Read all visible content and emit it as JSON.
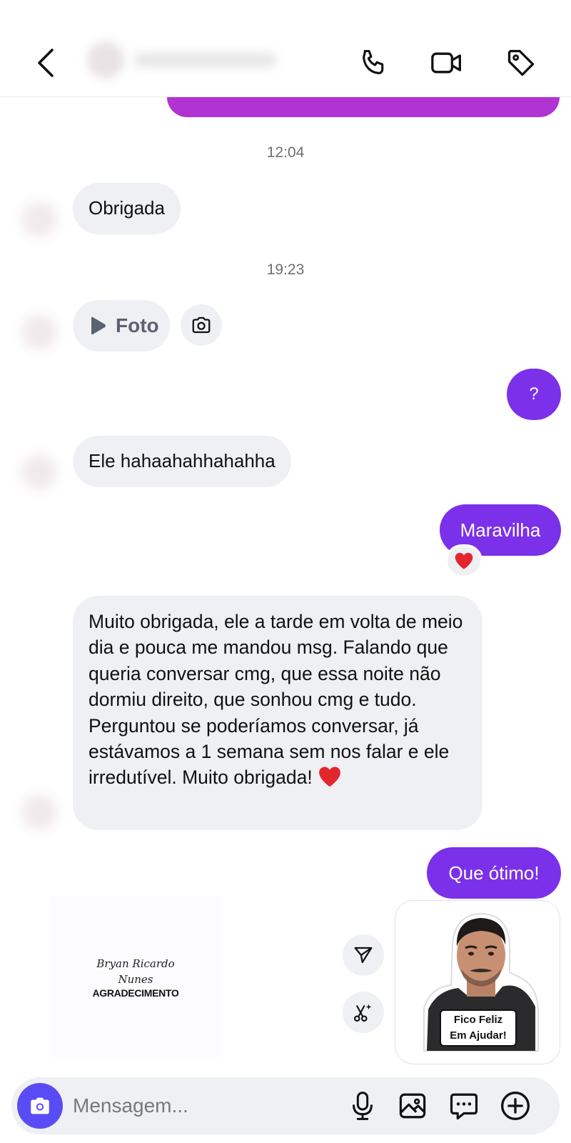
{
  "header": {
    "back_icon": "chevron-left-icon",
    "call_icon": "phone-icon",
    "video_icon": "video-camera-icon",
    "tag_icon": "tag-icon"
  },
  "messages": {
    "time_1": "12:04",
    "incoming_1": "Obrigada",
    "time_2": "19:23",
    "foto_label": "Foto",
    "outgoing_q": "?",
    "incoming_2": "Ele hahaahahhahahha",
    "outgoing_1": "Maravilha",
    "reaction_1": "❤️",
    "incoming_long": "Muito obrigada, ele a tarde em volta de meio dia e pouca me mandou msg. Falando que queria conversar cmg, que essa noite não dormiu direito, que sonhou cmg e tudo. Perguntou se poderíamos conversar, já estávamos a 1 semana sem nos falar e ele irredutível. Muito obrigada!",
    "incoming_long_emoji": "❤️",
    "outgoing_2": "Que ótimo!"
  },
  "stickers": {
    "left_script_1": "Bryan Ricardo",
    "left_script_2": "Nunes",
    "left_caps": "AGRADECIMENTO",
    "right_caption_1": "Fico Feliz",
    "right_caption_2": "Em Ajudar!"
  },
  "composer": {
    "placeholder": "Mensagem...",
    "camera_icon": "camera-icon",
    "mic_icon": "microphone-icon",
    "gallery_icon": "image-icon",
    "sticker_icon": "chat-bubble-icon",
    "add_icon": "plus-circle-icon"
  },
  "colors": {
    "outgoing_bubble": "#7b30ea",
    "incoming_bubble": "#eff0f3",
    "camera_button": "#5a4cf5"
  }
}
